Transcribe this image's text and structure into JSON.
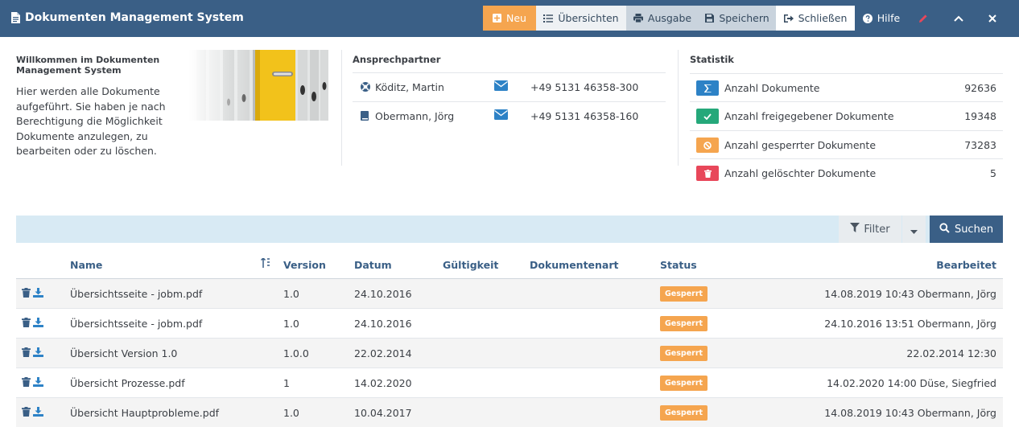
{
  "app": {
    "title": "Dokumenten Management System"
  },
  "toolbar": {
    "neu": "Neu",
    "uebersichten": "Übersichten",
    "ausgabe": "Ausgabe",
    "speichern": "Speichern",
    "schliessen": "Schließen",
    "hilfe": "Hilfe"
  },
  "welcome": {
    "title": "Willkommen im Dokumenten Management System",
    "text": "Hier werden alle Dokumente aufgeführt. Sie haben je nach Berechtigung die Möglichkeit Dokumente anzulegen, zu bearbeiten oder zu löschen."
  },
  "contacts": {
    "title": "Ansprechpartner",
    "items": [
      {
        "name": "Köditz, Martin",
        "phone": "+49 5131 46358-300",
        "icon": "lifebuoy-icon"
      },
      {
        "name": "Obermann, Jörg",
        "phone": "+49 5131 46358-160",
        "icon": "book-icon"
      }
    ]
  },
  "stats": {
    "title": "Statistik",
    "items": [
      {
        "label": "Anzahl Dokumente",
        "value": "92636",
        "color": "#2d82c6",
        "icon": "sigma-icon"
      },
      {
        "label": "Anzahl freigegebener Dokumente",
        "value": "19348",
        "color": "#25a87a",
        "icon": "check-icon"
      },
      {
        "label": "Anzahl gesperrter Dokumente",
        "value": "73283",
        "color": "#f5a54f",
        "icon": "ban-icon"
      },
      {
        "label": "Anzahl gelöschter Dokumente",
        "value": "5",
        "color": "#e8475a",
        "icon": "trash-icon"
      }
    ]
  },
  "search": {
    "filter": "Filter",
    "submit": "Suchen"
  },
  "table": {
    "headers": {
      "name": "Name",
      "version": "Version",
      "datum": "Datum",
      "gueltigkeit": "Gültigkeit",
      "dokumentenart": "Dokumentenart",
      "status": "Status",
      "bearbeitet": "Bearbeitet"
    },
    "rows": [
      {
        "name": "Übersichtsseite - jobm.pdf",
        "version": "1.0",
        "date": "24.10.2016",
        "status": "Gesperrt",
        "edited": "14.08.2019 10:43 Obermann, Jörg"
      },
      {
        "name": "Übersichtsseite - jobm.pdf",
        "version": "1.0",
        "date": "24.10.2016",
        "status": "Gesperrt",
        "edited": "24.10.2016 13:51 Obermann, Jörg"
      },
      {
        "name": "Übersicht Version 1.0",
        "version": "1.0.0",
        "date": "22.02.2014",
        "status": "Gesperrt",
        "edited": "22.02.2014 12:30"
      },
      {
        "name": "Übersicht Prozesse.pdf",
        "version": "1",
        "date": "14.02.2020",
        "status": "Gesperrt",
        "edited": "14.02.2020 14:00 Düse, Siegfried"
      },
      {
        "name": "Übersicht Hauptprobleme.pdf",
        "version": "1.0",
        "date": "10.04.2017",
        "status": "Gesperrt",
        "edited": "14.08.2019 10:43 Obermann, Jörg"
      }
    ]
  },
  "colors": {
    "header": "#3a5f86",
    "accent": "#f5a54f",
    "link": "#2d82c6"
  }
}
